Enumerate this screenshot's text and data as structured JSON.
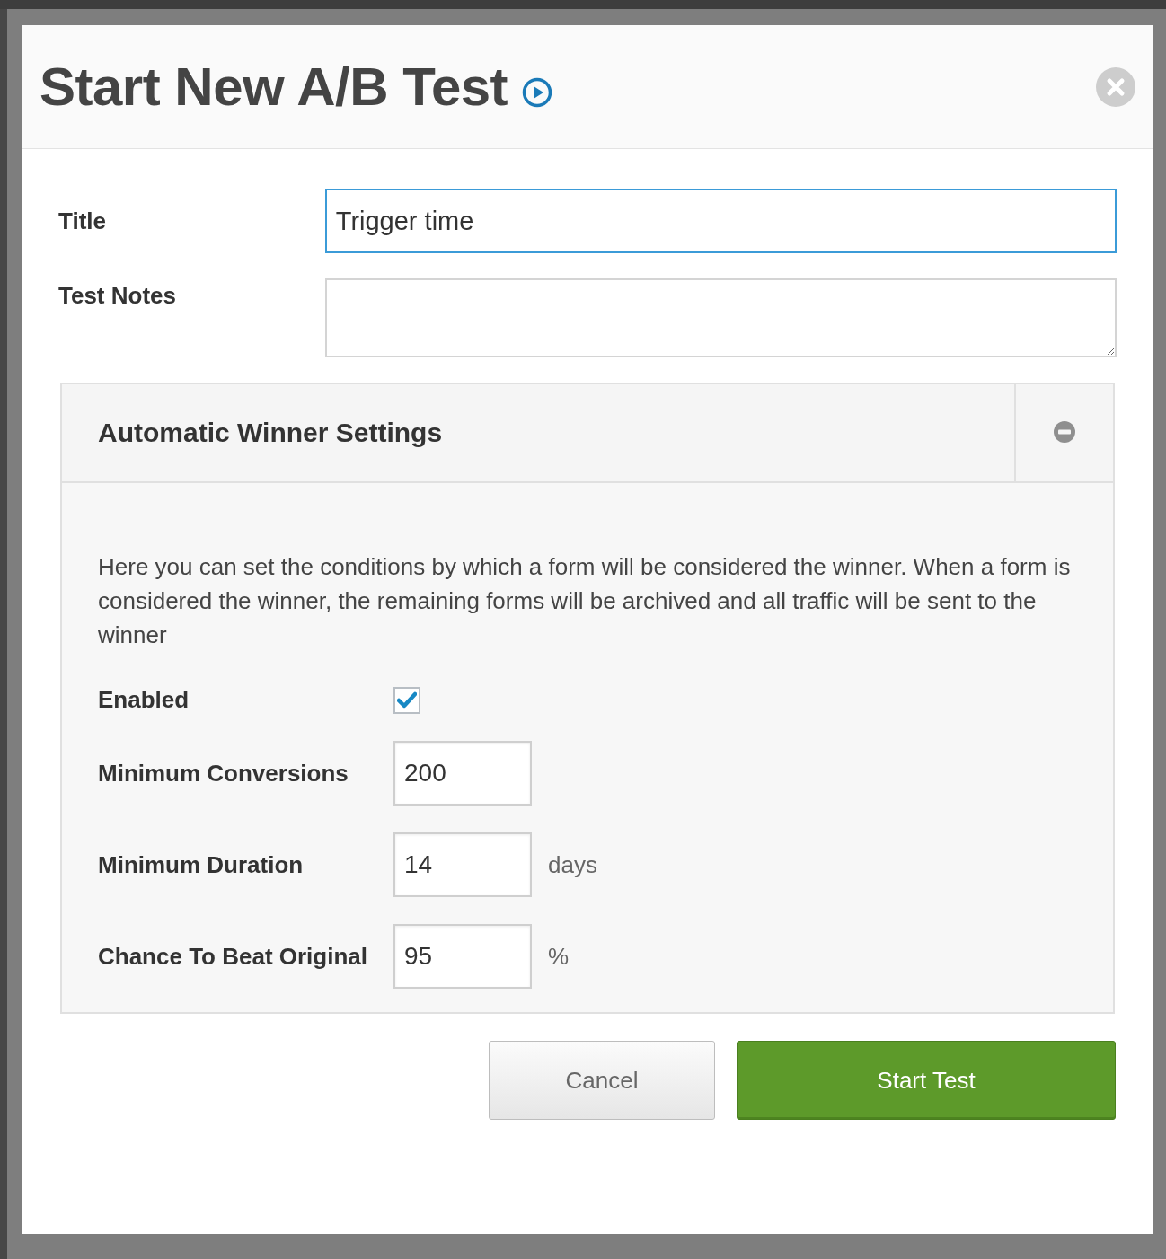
{
  "dialog": {
    "title": "Start New A/B Test",
    "fields": [
      {
        "label": "Title",
        "kind": "input",
        "value": "Trigger time",
        "focused": true
      },
      {
        "label": "Test Notes",
        "kind": "textarea",
        "focused": false
      }
    ],
    "panel": {
      "title": "Automatic Winner Settings",
      "expanded": true,
      "description": "Here you can set the conditions by which a form will be considered the winner. When a form is considered the winner, the remaining forms will be archived and all traffic will be sent to the winner",
      "settings": [
        {
          "kind": "checkbox",
          "label": "Enabled",
          "checked": true
        },
        {
          "kind": "number",
          "label": "Minimum Conversions",
          "value": "200"
        },
        {
          "kind": "number",
          "label": "Minimum Duration",
          "value": "14",
          "unit": "days"
        },
        {
          "kind": "number",
          "label": "Chance To Beat Original",
          "value": "95",
          "unit": "%"
        }
      ]
    },
    "buttons": [
      {
        "label": "Cancel",
        "kind": "secondary"
      },
      {
        "label": "Start Test",
        "kind": "primary"
      }
    ]
  }
}
